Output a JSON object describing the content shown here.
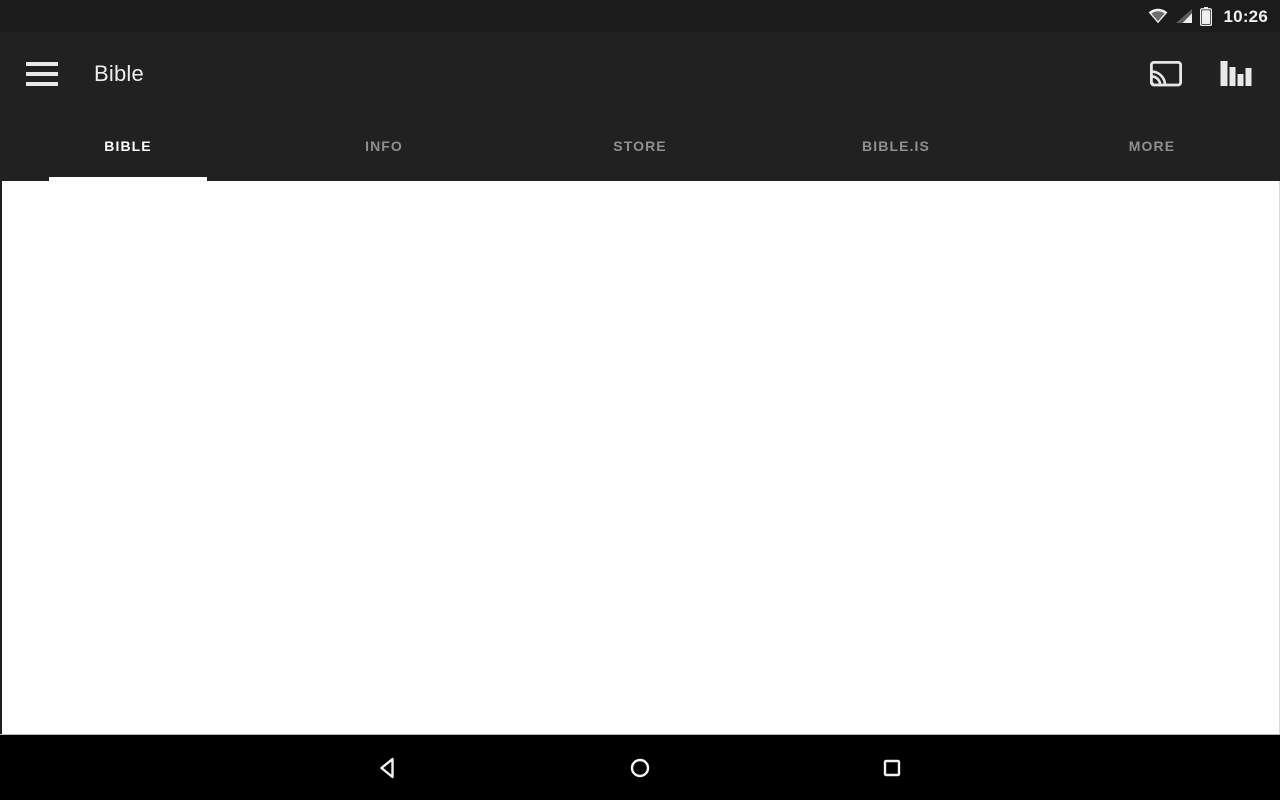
{
  "status_bar": {
    "time": "10:26",
    "icons": [
      "wifi-icon",
      "cellular-signal-icon",
      "battery-icon"
    ],
    "background": "#1b1b1b"
  },
  "action_bar": {
    "menu_icon": "hamburger-menu-icon",
    "title": "Bible",
    "cast_icon": "chromecast-icon",
    "chart_icon": "bar-chart-icon",
    "background": "#212121",
    "title_color": "#ededed"
  },
  "tabs": {
    "active_index": 0,
    "active_color": "#ffffff",
    "inactive_color": "#8f8f8f",
    "indicator_color": "#ffffff",
    "items": [
      {
        "label": "BIBLE"
      },
      {
        "label": "INFO"
      },
      {
        "label": "STORE"
      },
      {
        "label": "BIBLE.IS"
      },
      {
        "label": "MORE"
      }
    ]
  },
  "content": {
    "background": "#ffffff",
    "text": ""
  },
  "nav_bar": {
    "background": "#000000",
    "buttons": [
      {
        "name": "back-button",
        "icon": "triangle-back-icon"
      },
      {
        "name": "home-button",
        "icon": "circle-home-icon"
      },
      {
        "name": "recents-button",
        "icon": "square-recents-icon"
      }
    ]
  }
}
